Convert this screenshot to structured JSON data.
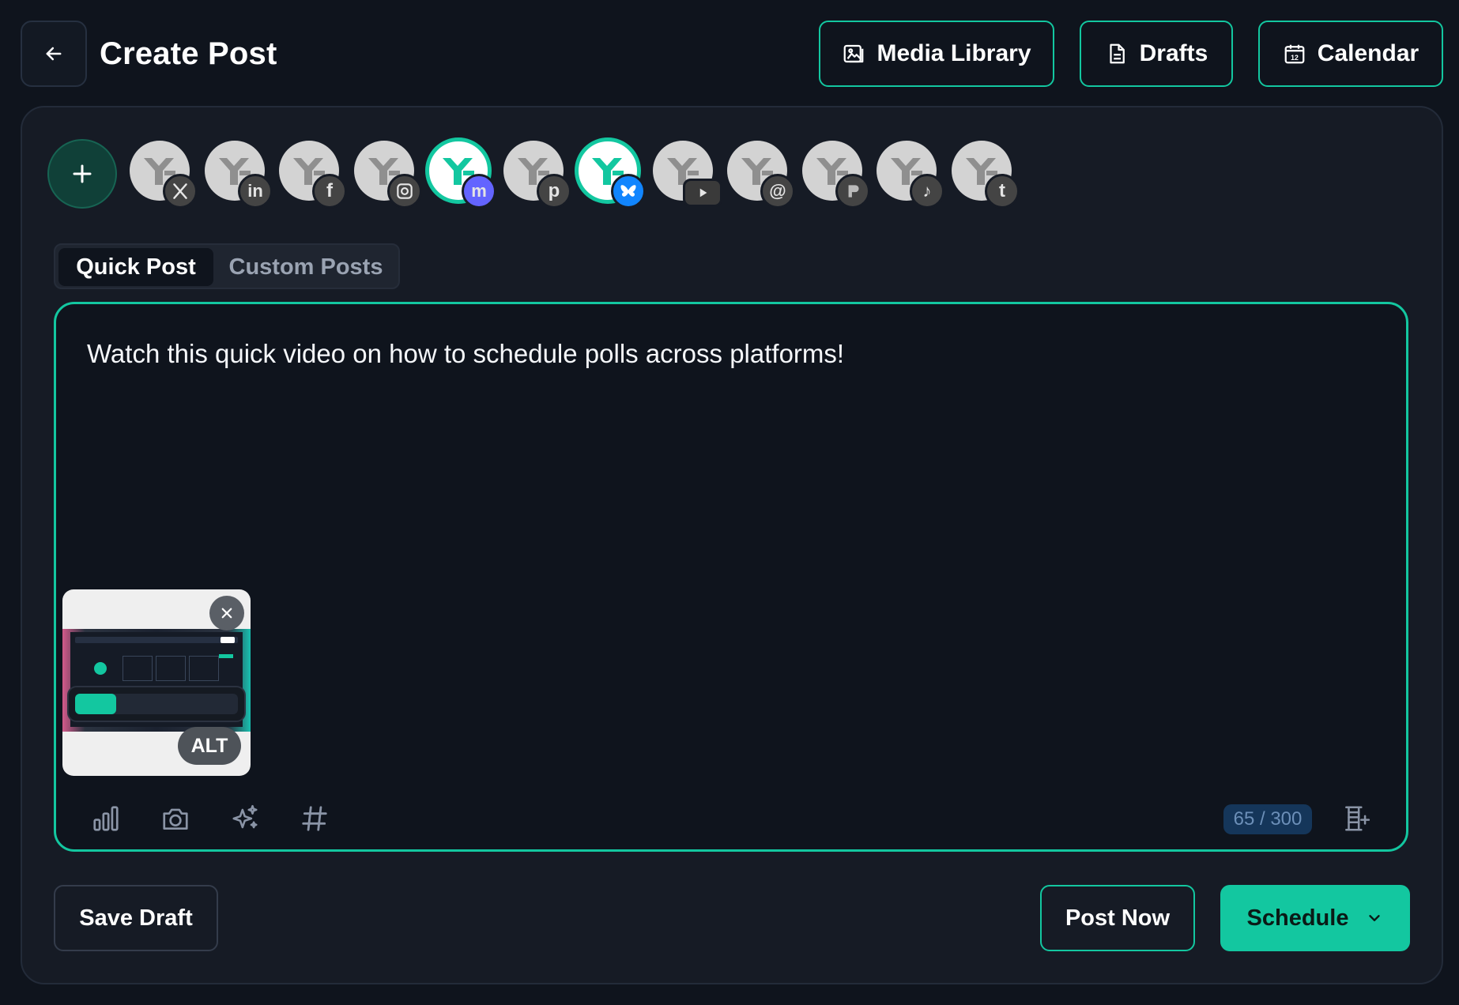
{
  "header": {
    "title": "Create Post",
    "media_library_label": "Media Library",
    "drafts_label": "Drafts",
    "calendar_label": "Calendar"
  },
  "accounts": [
    {
      "platform": "x",
      "selected": false
    },
    {
      "platform": "linkedin",
      "selected": false
    },
    {
      "platform": "facebook",
      "selected": false
    },
    {
      "platform": "instagram",
      "selected": false
    },
    {
      "platform": "mastodon",
      "selected": true
    },
    {
      "platform": "pinterest",
      "selected": false
    },
    {
      "platform": "bluesky",
      "selected": true
    },
    {
      "platform": "youtube",
      "selected": false
    },
    {
      "platform": "threads",
      "selected": false
    },
    {
      "platform": "google-business",
      "selected": false
    },
    {
      "platform": "tiktok",
      "selected": false
    },
    {
      "platform": "tumblr",
      "selected": false
    }
  ],
  "tabs": {
    "quick_post": "Quick Post",
    "custom_posts": "Custom Posts"
  },
  "editor": {
    "text": "Watch this quick video on how to schedule polls across platforms!",
    "media": {
      "alt_label": "ALT",
      "upload_progress": 0.25
    },
    "counter": "65 / 300"
  },
  "footer": {
    "save_draft_label": "Save Draft",
    "post_now_label": "Post Now",
    "schedule_label": "Schedule"
  },
  "colors": {
    "accent": "#13c7a0",
    "background": "#0f141d",
    "card": "#161b25",
    "mastodon": "#6364ff",
    "bluesky": "#1185fe"
  }
}
